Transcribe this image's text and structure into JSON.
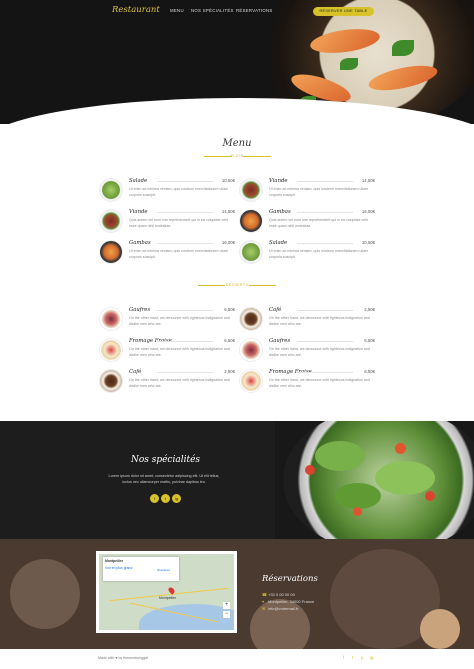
{
  "nav": {
    "logo": "Restaurant",
    "links": [
      "MENU",
      "NOS SPÉCIALITÉS",
      "RÉSERVATIONS"
    ],
    "cta": "RÉSERVER UNE TABLE"
  },
  "menu": {
    "title": "Menu",
    "plats_label": "PLATS",
    "desserts_label": "DESSERTS",
    "plats": [
      {
        "name": "Salade",
        "price": "10,50€",
        "desc": "Ut enim ad minima veniam, quis nostrum exercitationem ullam corporis suscipit."
      },
      {
        "name": "Viande",
        "price": "14,50€",
        "desc": "Ut enim ad minima veniam, quis nostrum exercitationem ullam corporis suscipit."
      },
      {
        "name": "Viande",
        "price": "14,50€",
        "desc": "Quis autem vel eum iure reprehenderit qui in ea voluptate velit esse quam nihil molestiae."
      },
      {
        "name": "Gambas",
        "price": "16,00€",
        "desc": "Quis autem vel eum iure reprehenderit qui in ea voluptate velit esse quam nihil molestiae."
      },
      {
        "name": "Gambas",
        "price": "16,00€",
        "desc": "Ut enim ad minima veniam, quis nostrum exercitationem ullam corporis suscipit."
      },
      {
        "name": "Salade",
        "price": "10,50€",
        "desc": "Ut enim ad minima veniam, quis nostrum exercitationem ullam corporis suscipit."
      }
    ],
    "desserts": [
      {
        "name": "Gaufres",
        "price": "6,50€",
        "desc": "On the other hand, we denounce with righteous indignation and dislike men who are."
      },
      {
        "name": "Café",
        "price": "2,50€",
        "desc": "On the other hand, we denounce with righteous indignation and dislike men who are."
      },
      {
        "name": "Fromage Fraise",
        "price": "6,50€",
        "desc": "On the other hand, we denounce with righteous indignation and dislike men who are."
      },
      {
        "name": "Gaufres",
        "price": "6,50€",
        "desc": "On the other hand, we denounce with righteous indignation and dislike men who are."
      },
      {
        "name": "Café",
        "price": "2,50€",
        "desc": "On the other hand, we denounce with righteous indignation and dislike men who are."
      },
      {
        "name": "Fromage Fraise",
        "price": "6,50€",
        "desc": "On the other hand, we denounce with righteous indignation and dislike men who are."
      }
    ]
  },
  "specialites": {
    "title": "Nos spécialités",
    "text": "Lorem ipsum dolor sit amet, consectetur adipiscing elit. Ut elit tellus, luctus nec ullamcorper mattis, pulvinar dapibus leo.",
    "social": [
      "f",
      "t",
      "ig"
    ]
  },
  "reservations": {
    "title": "Réservations",
    "phone": "+33 0 00 00 00",
    "address": "Montpellier, 34000 France",
    "email": "info@votremail.fr",
    "map": {
      "place": "Montpellier",
      "link": "Voir en plus grand",
      "city": "Montpellier",
      "directions": "Itinéraires"
    }
  },
  "footer": {
    "credit": "Made with ♥ by themeshonggal",
    "social": [
      "f",
      "t",
      "p",
      "ig"
    ]
  },
  "colors": {
    "accent": "#d8c22a",
    "dark": "#1d1d1d"
  }
}
